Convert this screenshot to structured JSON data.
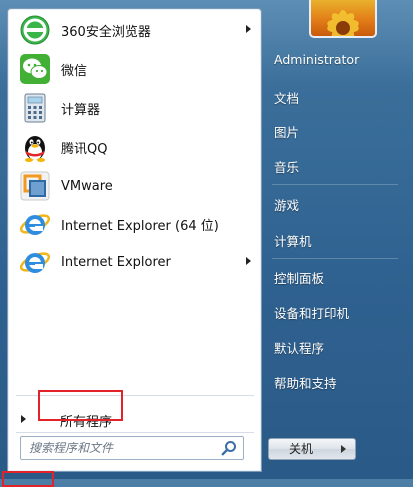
{
  "start_menu": {
    "pinned_programs": [
      {
        "label": "360安全浏览器",
        "icon": "360-browser-icon",
        "has_submenu": true
      },
      {
        "label": "微信",
        "icon": "wechat-icon",
        "has_submenu": false
      },
      {
        "label": "计算器",
        "icon": "calculator-icon",
        "has_submenu": false
      },
      {
        "label": "腾讯QQ",
        "icon": "qq-penguin-icon",
        "has_submenu": false
      },
      {
        "label": "VMware",
        "icon": "vmware-icon",
        "has_submenu": false
      },
      {
        "label": "Internet Explorer (64 位)",
        "icon": "internet-explorer-icon",
        "has_submenu": false
      },
      {
        "label": "Internet Explorer",
        "icon": "internet-explorer-icon",
        "has_submenu": true
      }
    ],
    "all_programs_label": "所有程序",
    "search": {
      "placeholder": "搜索程序和文件"
    },
    "right_pane": {
      "user": "Administrator",
      "items": [
        "文档",
        "图片",
        "音乐",
        "游戏",
        "计算机",
        "控制面板",
        "设备和打印机",
        "默认程序",
        "帮助和支持"
      ]
    },
    "shutdown_label": "关机",
    "highlight_color": "#e2242a"
  }
}
